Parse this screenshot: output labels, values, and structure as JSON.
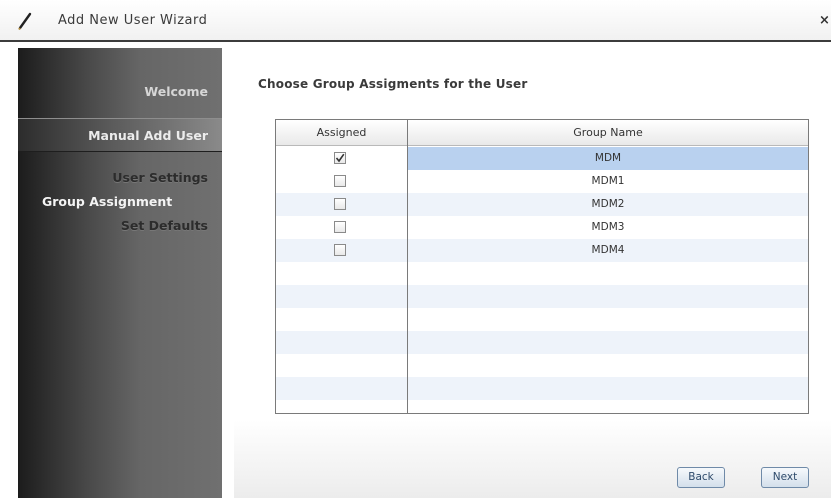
{
  "window": {
    "title": "Add New User Wizard",
    "close_glyph": "×",
    "icon": "pencil-icon"
  },
  "sidebar": {
    "items": [
      {
        "label": "Welcome",
        "state": "visited"
      },
      {
        "label": "Manual Add User",
        "state": "active-section"
      },
      {
        "label": "User Settings",
        "state": "inactive"
      },
      {
        "label": "Group Assignment",
        "state": "current"
      },
      {
        "label": "Set Defaults",
        "state": "inactive"
      }
    ]
  },
  "main": {
    "heading": "Choose Group Assigments for the User",
    "table": {
      "columns": [
        "Assigned",
        "Group Name"
      ],
      "rows": [
        {
          "assigned": true,
          "group": "MDM",
          "selected": true
        },
        {
          "assigned": false,
          "group": "MDM1",
          "selected": false
        },
        {
          "assigned": false,
          "group": "MDM2",
          "selected": false
        },
        {
          "assigned": false,
          "group": "MDM3",
          "selected": false
        },
        {
          "assigned": false,
          "group": "MDM4",
          "selected": false
        }
      ]
    }
  },
  "footer": {
    "back_label": "Back",
    "next_label": "Next"
  },
  "colors": {
    "selected_row": "#b9d1ef",
    "alt_row": "#eef3fa",
    "button_text": "#2e4a6b"
  }
}
